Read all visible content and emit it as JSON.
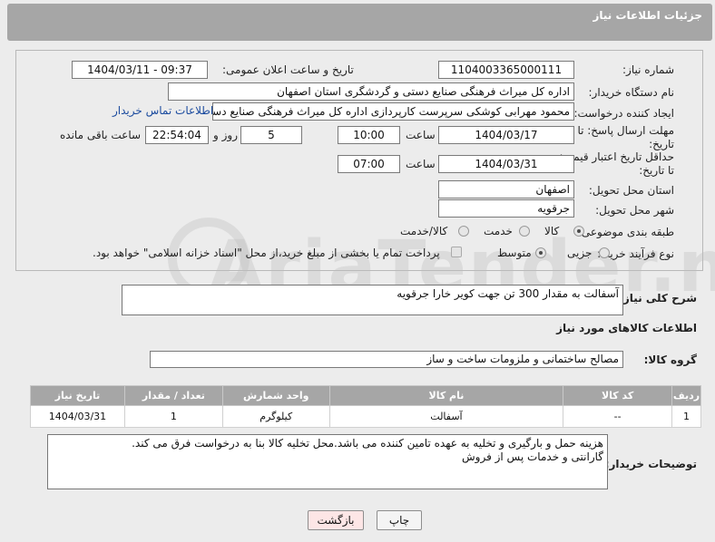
{
  "header": {
    "title": "جزئیات اطلاعات نیاز"
  },
  "form": {
    "need_number_label": "شماره نیاز:",
    "need_number": "1104003365000111",
    "announce_label": "تاریخ و ساعت اعلان عمومی:",
    "announce_value": "1404/03/11 - 09:37",
    "buyer_org_label": "نام دستگاه خریدار:",
    "buyer_org": "اداره کل میراث فرهنگی  صنایع دستی و گردشگری استان اصفهان",
    "creator_label": "ایجاد کننده درخواست:",
    "creator": "محمود مهرابی کوشکی سرپرست کارپردازی اداره کل میراث فرهنگی  صنایع دستی",
    "contact_link": "اطلاعات تماس خریدار",
    "deadline_label": "مهلت ارسال پاسخ: تا تاریخ:",
    "deadline_date": "1404/03/17",
    "time_label": "ساعت",
    "deadline_time": "10:00",
    "days_value": "5",
    "days_label": "روز و",
    "remaining_time": "22:54:04",
    "remaining_label": "ساعت باقی مانده",
    "price_validity_label": "حداقل تاریخ اعتبار قیمت: تا تاریخ:",
    "price_date": "1404/03/31",
    "price_time": "07:00",
    "province_label": "استان محل تحویل:",
    "province": "اصفهان",
    "city_label": "شهر محل تحویل:",
    "city": "جرقویه",
    "category_label": "طبقه بندی موضوعی:",
    "category_options": [
      "کالا",
      "خدمت",
      "کالا/خدمت"
    ],
    "process_label": "نوع فرآیند خرید :",
    "process_options": [
      "جزیی",
      "متوسط"
    ],
    "payment_note": "پرداخت تمام یا بخشی از مبلغ خرید،از محل \"اسناد خزانه اسلامی\" خواهد بود."
  },
  "summary": {
    "label": "شرح کلی نیاز:",
    "text": "آسفالت به مقدار 300 تن جهت کویر خارا جرقویه"
  },
  "goods_section": {
    "title": "اطلاعات کالاهای مورد نیاز",
    "group_label": "گروه کالا:",
    "group_value": "مصالح ساختمانی و ملزومات ساخت و ساز"
  },
  "table": {
    "headers": [
      "ردیف",
      "کد کالا",
      "نام کالا",
      "واحد شمارش",
      "تعداد / مقدار",
      "تاریخ نیاز"
    ],
    "rows": [
      [
        "1",
        "--",
        "آسفالت",
        "کیلوگرم",
        "1",
        "1404/03/31"
      ]
    ]
  },
  "buyer_notes": {
    "label": "توضیحات خریدار:",
    "line1": "هزینه حمل و بارگیری و تخلیه به عهده تامین کننده می باشد.محل تخلیه کالا بنا به درخواست فرق می کند.",
    "line2": "گارانتی و خدمات پس از فروش"
  },
  "buttons": {
    "print": "چاپ",
    "back": "بازگشت"
  },
  "watermark": "AriaTender.neT"
}
